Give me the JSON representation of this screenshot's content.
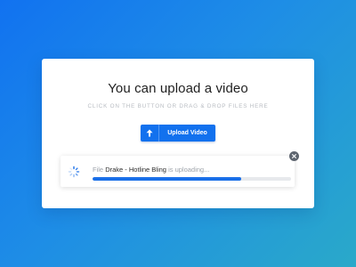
{
  "dialog": {
    "title": "You can upload a video",
    "subtitle": "CLICK ON THE BUTTON OR DRAG & DROP FILES HERE",
    "upload_button_label": "Upload Video",
    "upload_icon": "arrow-up-icon"
  },
  "upload": {
    "prefix": "File",
    "filename": "Drake - Hotline Bling",
    "suffix": "is uploading...",
    "progress": 0.75,
    "spinner_icon": "spinner-icon",
    "close_icon": "close-icon"
  },
  "colors": {
    "accent": "#1271ee",
    "progress_fill": "#1a6fe8",
    "progress_track": "#e7e9ec",
    "close_button": "#5f6670"
  }
}
